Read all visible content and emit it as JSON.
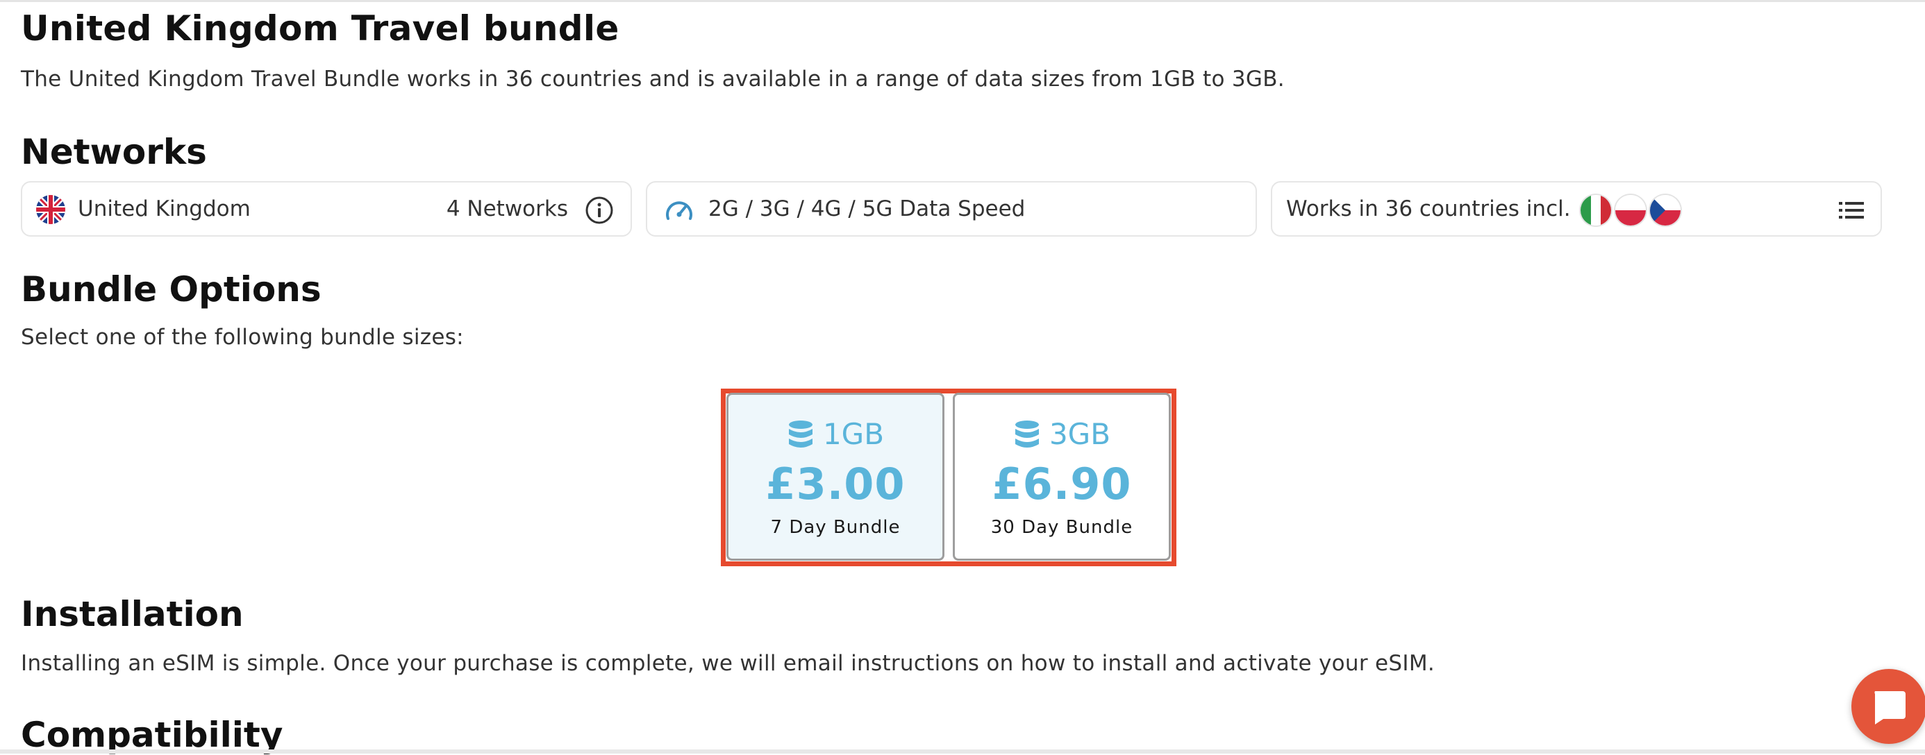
{
  "page": {
    "title": "United Kingdom Travel bundle",
    "description": "The United Kingdom Travel Bundle works in 36 countries and is available in a range of data sizes from 1GB to 3GB."
  },
  "networks": {
    "heading": "Networks",
    "country": {
      "flag_icon": "uk-flag-icon",
      "label": "United Kingdom",
      "count": "4 Networks",
      "info_icon": "info-icon"
    },
    "speed": {
      "icon": "speedometer-icon",
      "label": "2G / 3G / 4G / 5G Data Speed"
    },
    "coverage": {
      "label": "Works in 36 countries incl.",
      "flags": [
        "italy-flag-icon",
        "poland-flag-icon",
        "czech-flag-icon"
      ],
      "list_icon": "list-icon"
    }
  },
  "bundle_options": {
    "heading": "Bundle Options",
    "instruction": "Select one of the following bundle sizes:",
    "options": [
      {
        "data": "1GB",
        "price": "£3.00",
        "term": "7 Day Bundle",
        "selected": true
      },
      {
        "data": "3GB",
        "price": "£6.90",
        "term": "30 Day Bundle",
        "selected": false
      }
    ]
  },
  "installation": {
    "heading": "Installation",
    "text": "Installing an eSIM is simple. Once your purchase is complete, we will email instructions on how to install and activate your eSIM."
  },
  "compatibility": {
    "heading": "Compatibility"
  },
  "chat": {
    "icon": "chat-icon"
  },
  "colors": {
    "accent": "#5ab4da",
    "highlight_frame": "#e64a2e",
    "chat_button": "#e4553a",
    "selected_bg": "#eef7fb"
  }
}
